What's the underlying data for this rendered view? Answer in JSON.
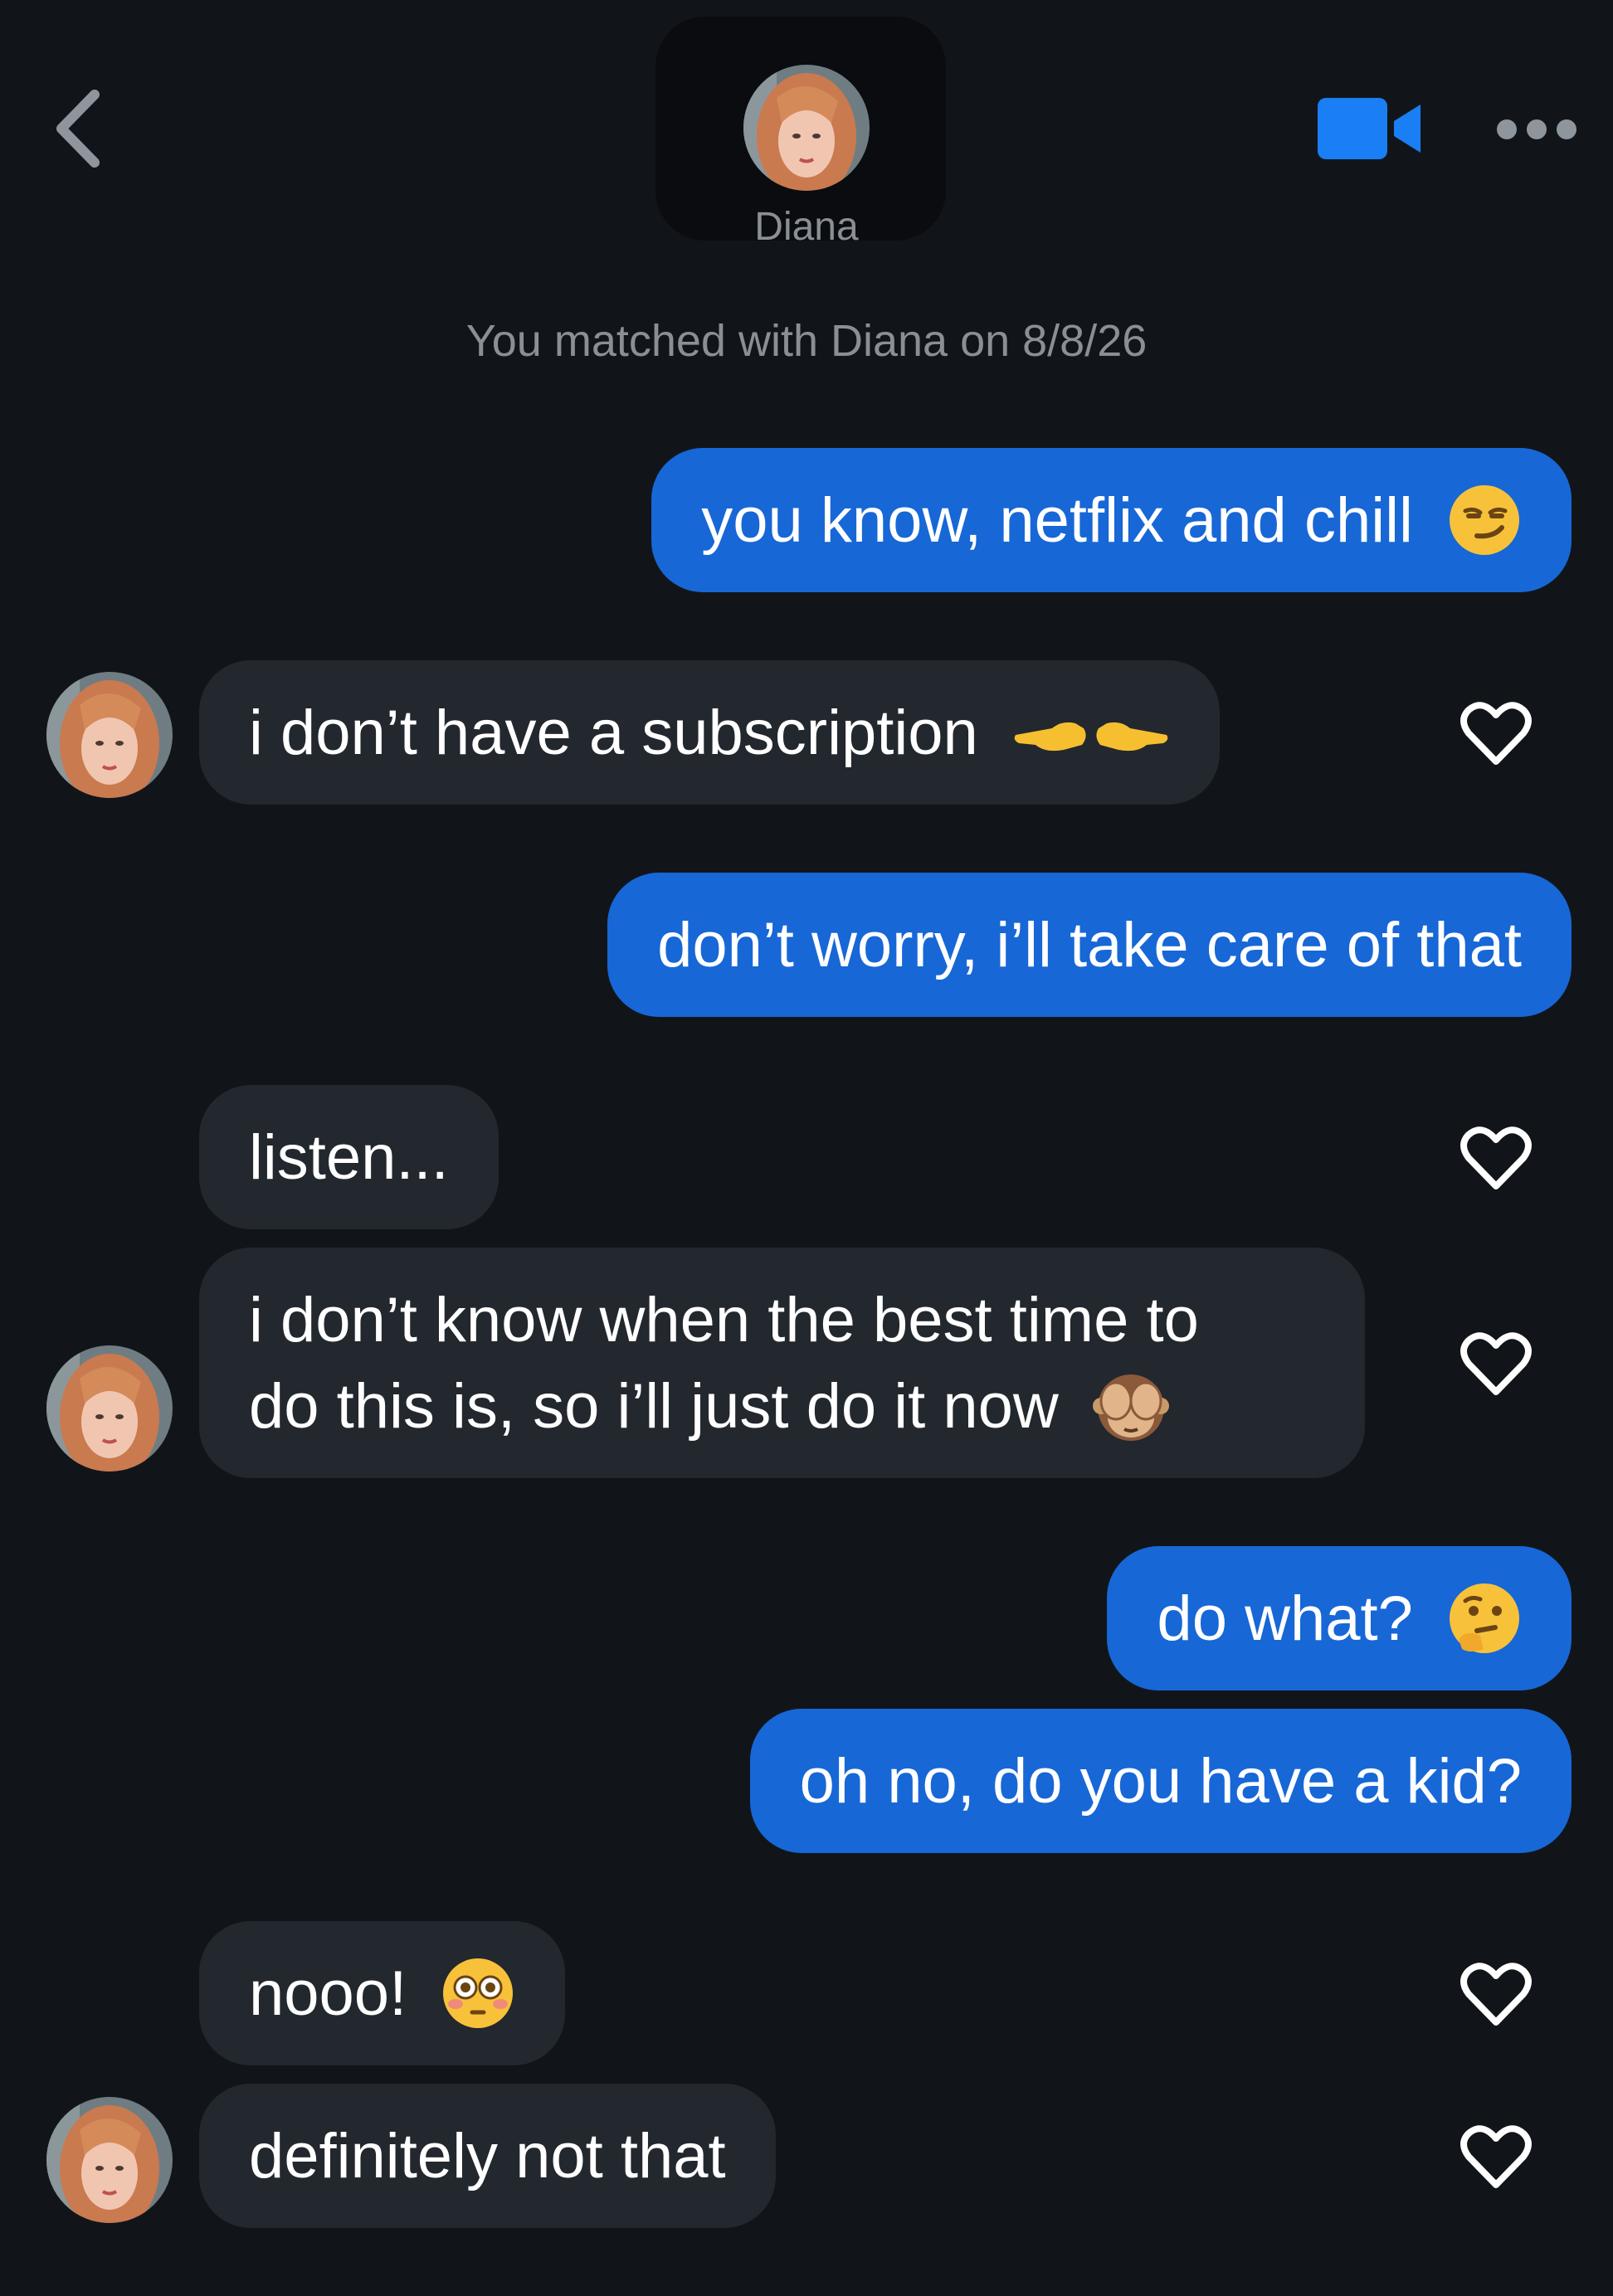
{
  "header": {
    "name": "Diana",
    "back_icon": "chevron-left-icon",
    "video_icon": "video-camera-icon",
    "more_icon": "ellipsis-icon",
    "accent_color": "#1a7ef4"
  },
  "match_note": "You matched with Diana on 8/8/26",
  "messages": [
    {
      "side": "sent",
      "text": "you know, netflix and chill",
      "emoji": "smirking-face"
    },
    {
      "side": "received",
      "text": "i don’t have a subscription",
      "emoji": "pointing-hands",
      "liked": false
    },
    {
      "side": "sent",
      "text": "don’t worry, i’ll take care of that"
    },
    {
      "side": "received",
      "text": "listen...",
      "liked": false
    },
    {
      "side": "received",
      "line1": "i don’t know when the best time to",
      "line2": "do this is, so i’ll just do it now",
      "emoji": "see-no-evil-monkey",
      "liked": false
    },
    {
      "side": "sent",
      "text": "do what?",
      "emoji": "thinking-face"
    },
    {
      "side": "sent",
      "text": "oh no, do you have a kid?"
    },
    {
      "side": "received",
      "text": "nooo!",
      "emoji": "flushed-face",
      "liked": false
    },
    {
      "side": "received",
      "text": "definitely not that",
      "liked": false
    }
  ],
  "colors": {
    "background": "#11151a",
    "sent_bubble": "#1767d6",
    "received_bubble": "#23272e",
    "muted_text": "#8a8f96"
  }
}
